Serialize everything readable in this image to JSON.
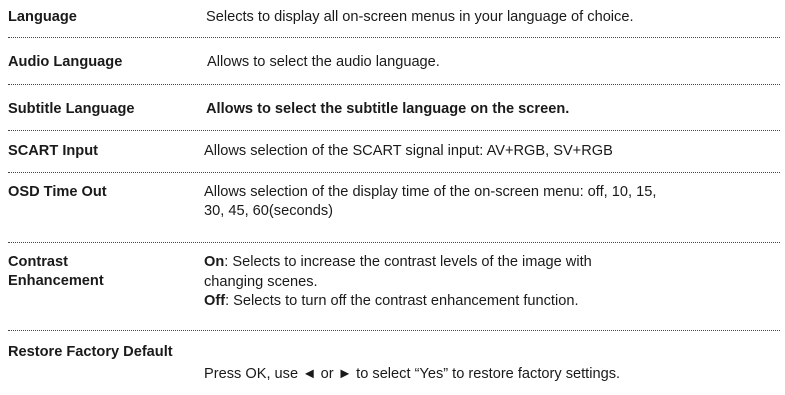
{
  "rows": [
    {
      "label": "Language",
      "desc": "Selects to display all on-screen menus in your language of choice."
    },
    {
      "label": "Audio Language",
      "desc": "Allows to select the audio language."
    },
    {
      "label": "Subtitle Language",
      "desc": "Allows to select the subtitle language on the screen."
    },
    {
      "label": "SCART Input",
      "desc": "Allows selection of the SCART signal input: AV+RGB, SV+RGB"
    },
    {
      "label": "OSD Time Out",
      "desc_line1": "Allows selection of the display time of the on-screen menu: off, 10, 15,",
      "desc_line2": "30, 45, 60(seconds)"
    },
    {
      "label_line1": "Contrast",
      "label_line2": "Enhancement",
      "on_label": "On",
      "on_text_line1": ": Selects to increase the contrast levels of the image with",
      "on_text_line2": "changing scenes.",
      "off_label": "Off",
      "off_text": ": Selects to turn off the contrast enhancement function."
    },
    {
      "label": "Restore Factory Default",
      "desc": "Press OK, use ◄ or ► to select “Yes” to restore factory settings."
    }
  ]
}
